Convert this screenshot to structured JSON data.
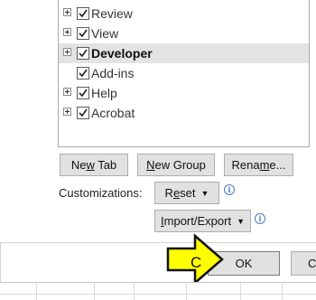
{
  "tree": {
    "items": [
      {
        "label": "Review",
        "checked": true,
        "expander": true,
        "selected": false,
        "bold": false
      },
      {
        "label": "View",
        "checked": true,
        "expander": true,
        "selected": false,
        "bold": false
      },
      {
        "label": "Developer",
        "checked": true,
        "expander": true,
        "selected": true,
        "bold": true
      },
      {
        "label": "Add-ins",
        "checked": true,
        "expander": false,
        "selected": false,
        "bold": false
      },
      {
        "label": "Help",
        "checked": true,
        "expander": true,
        "selected": false,
        "bold": false
      },
      {
        "label": "Acrobat",
        "checked": true,
        "expander": true,
        "selected": false,
        "bold": false
      }
    ]
  },
  "buttons": {
    "new_tab_pre": "Ne",
    "new_tab_u": "w",
    "new_tab_post": " Tab",
    "new_group_pre": "",
    "new_group_u": "N",
    "new_group_post": "ew Group",
    "rename_pre": "Rena",
    "rename_u": "m",
    "rename_post": "e...",
    "reset_pre": "R",
    "reset_u": "e",
    "reset_post": "set",
    "import_pre": "",
    "import_u": "I",
    "import_post": "mport/Export",
    "ok": "OK",
    "cancel_partial": "Ca"
  },
  "customizations_label": "Customizations:",
  "annotation": {
    "letter": "C",
    "arrow_color": "#ffff00"
  },
  "colors": {
    "accent": "#1a5fb4",
    "selected_row": "#e3e3e3",
    "info": "#4a78c2"
  }
}
